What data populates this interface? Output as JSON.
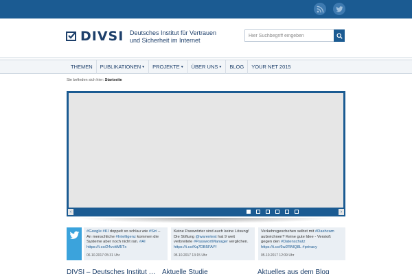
{
  "topbar": {
    "social": [
      "rss-icon",
      "twitter-icon"
    ],
    "color": "#1b5b92"
  },
  "header": {
    "logo_text": "DIVSI",
    "subtitle_line1": "Deutsches Institut für Vertrauen",
    "subtitle_line2": "und Sicherheit im Internet",
    "search_placeholder": "Hier Suchbegriff eingeben"
  },
  "nav": {
    "items": [
      {
        "label": "THEMEN",
        "dropdown": false
      },
      {
        "label": "PUBLIKATIONEN",
        "dropdown": true
      },
      {
        "label": "PROJEKTE",
        "dropdown": true
      },
      {
        "label": "ÜBER UNS",
        "dropdown": true
      },
      {
        "label": "BLOG",
        "dropdown": false
      },
      {
        "label": "YOUR NET 2015",
        "dropdown": false
      }
    ]
  },
  "breadcrumb": {
    "prefix": "Sie befinden sich hier:",
    "current": "Startseite"
  },
  "slider": {
    "prev_arrow": "‹",
    "next_arrow": "›",
    "slide_count": 6,
    "active_index": 0
  },
  "tweets": [
    {
      "segments": [
        {
          "text": "#Google",
          "tag": true
        },
        {
          "text": " ",
          "tag": false
        },
        {
          "text": "#KI",
          "tag": true
        },
        {
          "text": " doppelt so schlau wie ",
          "tag": false
        },
        {
          "text": "#Siri",
          "tag": true
        },
        {
          "text": " – An menschliche ",
          "tag": false
        },
        {
          "text": "#Intelligenz",
          "tag": true
        },
        {
          "text": " kommen die Systeme aber noch nicht ran. ",
          "tag": false
        },
        {
          "text": "#AI",
          "tag": true
        },
        {
          "text": " ",
          "tag": false
        },
        {
          "text": "https://t.co/24vcttM5Tx",
          "tag": true
        }
      ],
      "date": "06.10.2017 05:31 Uhr"
    },
    {
      "segments": [
        {
          "text": "Keine Passwörter sind auch keine Lösung! Die Stiftung ",
          "tag": false
        },
        {
          "text": "@warentest",
          "tag": true
        },
        {
          "text": " hat 9 weit verbreitete ",
          "tag": false
        },
        {
          "text": "#PasswortManager",
          "tag": true
        },
        {
          "text": " verglichen. ",
          "tag": false
        },
        {
          "text": "https://t.co/Kq7DB5FAYf",
          "tag": true
        }
      ],
      "date": "05.10.2017 13:15 Uhr"
    },
    {
      "segments": [
        {
          "text": "Verkehrsgeschehen selbst mit ",
          "tag": false
        },
        {
          "text": "#Dashcam",
          "tag": true
        },
        {
          "text": " aufzeichnen? Keine gute Idee - Verstoß gegen den ",
          "tag": false
        },
        {
          "text": "#Datenschutz",
          "tag": true
        },
        {
          "text": " ",
          "tag": false
        },
        {
          "text": "https://t.co/6w2RMQ8L",
          "tag": true
        },
        {
          "text": " ",
          "tag": false
        },
        {
          "text": "#privacy",
          "tag": true
        }
      ],
      "date": "05.10.2017 12:09 Uhr"
    }
  ],
  "bottom": {
    "heading1": "DIVSI – Deutsches Institut …",
    "heading2": "Aktuelle Studie",
    "heading3": "Aktuelles aus dem Blog"
  }
}
